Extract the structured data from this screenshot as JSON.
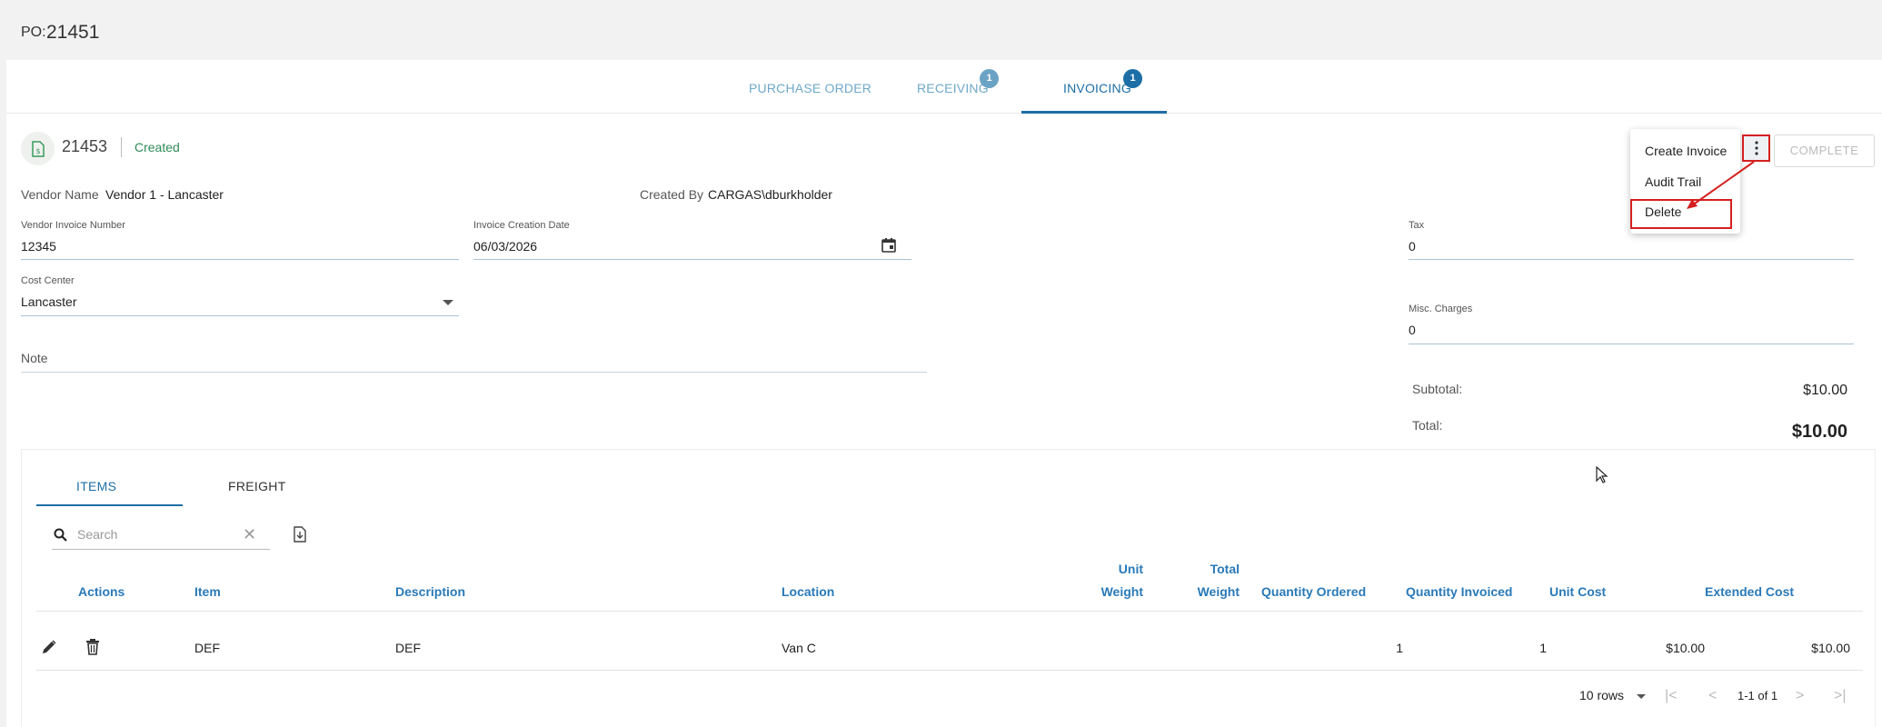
{
  "header": {
    "po_prefix": "PO:",
    "po_number": "21451"
  },
  "top_tabs": [
    {
      "label": "PURCHASE ORDER",
      "badge": ""
    },
    {
      "label": "RECEIVING",
      "badge": "1"
    },
    {
      "label": "INVOICING",
      "badge": "1",
      "active": true
    }
  ],
  "invoice": {
    "number": "21453",
    "status": "Created",
    "vendor_name_label": "Vendor Name",
    "vendor_name": "Vendor 1 - Lancaster",
    "created_by_label": "Created By",
    "created_by": "CARGAS\\dburkholder",
    "vendor_invoice_number_label": "Vendor Invoice Number",
    "vendor_invoice_number": "12345",
    "invoice_creation_date_label": "Invoice Creation Date",
    "invoice_creation_date": "06/03/2026",
    "cost_center_label": "Cost Center",
    "cost_center": "Lancaster",
    "note_placeholder": "Note",
    "tax_label": "Tax",
    "tax": "0",
    "misc_charges_label": "Misc. Charges",
    "misc_charges": "0",
    "subtotal_label": "Subtotal:",
    "subtotal": "$10.00",
    "total_label": "Total:",
    "total": "$10.00"
  },
  "menu": {
    "items": [
      "Create Invoice",
      "Audit Trail",
      "Delete"
    ],
    "complete_label": "COMPLETE"
  },
  "sub_tabs": [
    {
      "label": "ITEMS",
      "active": true
    },
    {
      "label": "FREIGHT"
    }
  ],
  "search": {
    "placeholder": "Search"
  },
  "table": {
    "headers": {
      "actions": "Actions",
      "item": "Item",
      "description": "Description",
      "location": "Location",
      "unit_weight_1": "Unit",
      "unit_weight_2": "Weight",
      "total_weight_1": "Total",
      "total_weight_2": "Weight",
      "quantity_ordered": "Quantity Ordered",
      "quantity_invoiced": "Quantity Invoiced",
      "unit_cost": "Unit Cost",
      "extended_cost": "Extended Cost"
    },
    "rows": [
      {
        "item": "DEF",
        "description": "DEF",
        "location": "Van C",
        "unit_weight": "",
        "total_weight": "",
        "quantity_ordered": "1",
        "quantity_invoiced": "1",
        "unit_cost": "$10.00",
        "extended_cost": "$10.00"
      }
    ]
  },
  "pagination": {
    "rows_label": "10 rows",
    "range": "1-1 of 1"
  },
  "colors": {
    "accent": "#1d6ea6",
    "status_green": "#2e8b57",
    "highlight_red": "#d42020"
  }
}
